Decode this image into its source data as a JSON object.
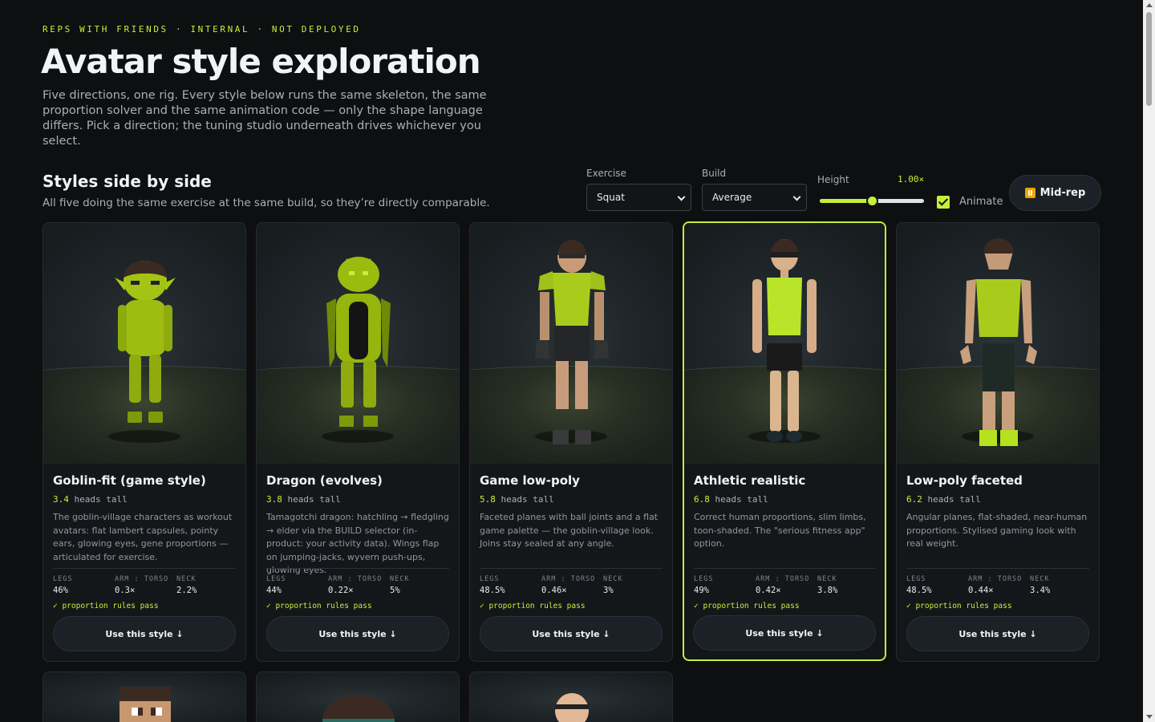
{
  "header": {
    "eyebrow": "REPS WITH FRIENDS · INTERNAL · NOT DEPLOYED",
    "title": "Avatar style exploration",
    "intro": "Five directions, one rig. Every style below runs the same skeleton, the same proportion solver and the same animation code — only the shape language differs. Pick a direction; the tuning studio underneath drives whichever you select."
  },
  "section": {
    "title": "Styles side by side",
    "subtitle": "All five doing the same exercise at the same build, so they’re directly comparable."
  },
  "controls": {
    "exercise_label": "Exercise",
    "exercise_value": "Squat",
    "build_label": "Build",
    "build_value": "Average",
    "height_label": "Height",
    "height_value": "1.00×",
    "height_fraction": 0.5,
    "animate_label": "Animate",
    "animate_checked": true,
    "midrep_label": "Mid-rep"
  },
  "metric_labels": {
    "legs": "LEGS",
    "arm_torso": "ARM : TORSO",
    "neck": "NECK"
  },
  "cards": [
    {
      "title": "Goblin-fit (game style)",
      "heads": "3.4",
      "heads_suffix": "heads tall",
      "desc": "The goblin-village characters as workout avatars: flat lambert capsules, pointy ears, glowing eyes, gene proportions — articulated for exercise.",
      "legs": "46%",
      "arm_torso": "0.3×",
      "neck": "2.2%",
      "pass": "✓ proportion rules pass",
      "button": "Use this style ↓",
      "selected": false
    },
    {
      "title": "Dragon (evolves)",
      "heads": "3.8",
      "heads_suffix": "heads tall",
      "desc": "Tamagotchi dragon: hatchling → fledgling → elder via the BUILD selector (in-product: your activity data). Wings flap on jumping-jacks, wyvern push-ups, glowing eyes.",
      "legs": "44%",
      "arm_torso": "0.22×",
      "neck": "5%",
      "pass": "✓ proportion rules pass",
      "button": "Use this style ↓",
      "selected": false
    },
    {
      "title": "Game low-poly",
      "heads": "5.8",
      "heads_suffix": "heads tall",
      "desc": "Faceted planes with ball joints and a flat game palette — the goblin-village look. Joins stay sealed at any angle.",
      "legs": "48.5%",
      "arm_torso": "0.46×",
      "neck": "3%",
      "pass": "✓ proportion rules pass",
      "button": "Use this style ↓",
      "selected": false
    },
    {
      "title": "Athletic realistic",
      "heads": "6.8",
      "heads_suffix": "heads tall",
      "desc": "Correct human proportions, slim limbs, toon-shaded. The \"serious fitness app\" option.",
      "legs": "49%",
      "arm_torso": "0.42×",
      "neck": "3.8%",
      "pass": "✓ proportion rules pass",
      "button": "Use this style ↓",
      "selected": true
    },
    {
      "title": "Low-poly faceted",
      "heads": "6.2",
      "heads_suffix": "heads tall",
      "desc": "Angular planes, flat-shaded, near-human proportions. Stylised gaming look with real weight.",
      "legs": "48.5%",
      "arm_torso": "0.44×",
      "neck": "3.4%",
      "pass": "✓ proportion rules pass",
      "button": "Use this style ↓",
      "selected": false
    }
  ],
  "colors": {
    "accent": "#c6ef3a",
    "background": "#0d0f11",
    "card": "#14171a",
    "muted_text": "#a9b0b8",
    "pause_icon": "#f2a200"
  }
}
